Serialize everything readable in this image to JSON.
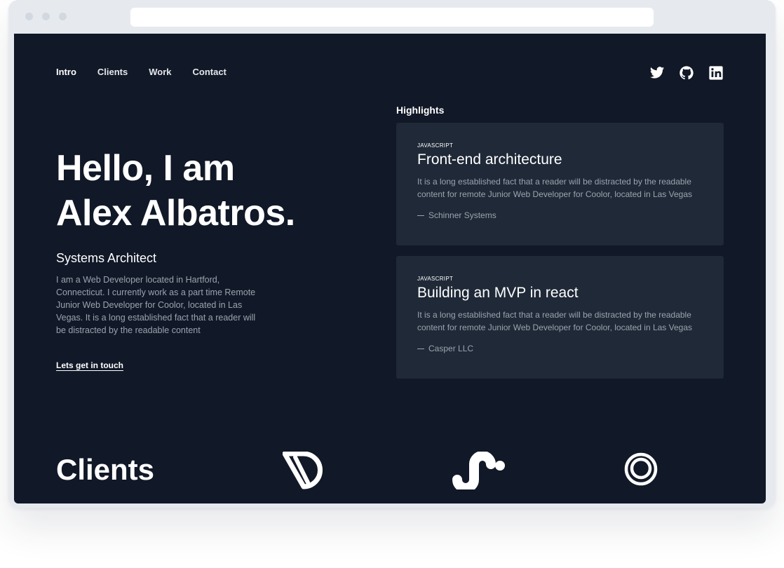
{
  "nav": {
    "items": [
      "Intro",
      "Clients",
      "Work",
      "Contact"
    ]
  },
  "social": {
    "icons": [
      "twitter-icon",
      "github-icon",
      "linkedin-icon"
    ]
  },
  "hero": {
    "title_line1": "Hello, I am",
    "title_line2": "Alex Albatros.",
    "role": "Systems Architect",
    "bio": "I am a Web Developer located in Hartford, Connecticut. I currently work as a part time Remote Junior Web Developer for Coolor, located in Las Vegas. It is a long established fact that a reader will be distracted by the readable content",
    "cta": "Lets get in touch"
  },
  "highlights": {
    "heading": "Highlights",
    "cards": [
      {
        "tag": "JAVASCRIPT",
        "title": "Front-end architecture",
        "description": "It is a long established fact that a reader will be distracted by the readable content for remote Junior Web Developer for Coolor, located in Las Vegas",
        "company": "Schinner Systems"
      },
      {
        "tag": "JAVASCRIPT",
        "title": "Building an MVP in react",
        "description": "It is a long established fact that a reader will be distracted by the readable content for remote Junior Web Developer for Coolor, located in Las Vegas",
        "company": "Casper LLC"
      }
    ]
  },
  "clients": {
    "heading": "Clients"
  },
  "colors": {
    "page_bg": "#111827",
    "card_bg": "#1f2937",
    "text_primary": "#ffffff",
    "text_muted": "#9ca3af"
  }
}
